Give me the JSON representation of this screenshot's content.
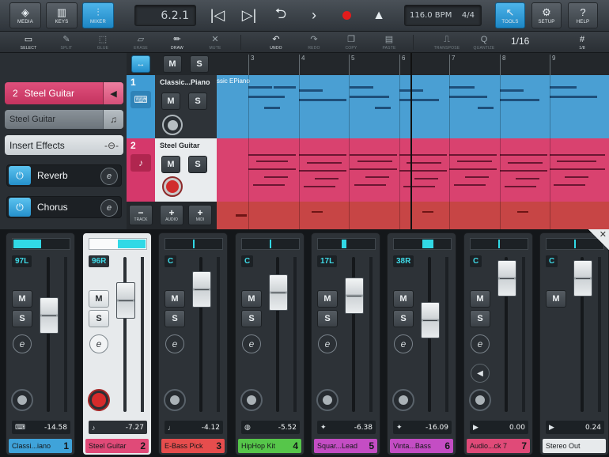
{
  "toolbar": {
    "media": "MEDIA",
    "keys": "KEYS",
    "mixer": "MIXER",
    "position": "6.2.1",
    "tempo": "116.0 BPM",
    "signature": "4/4",
    "tools": "TOOLS",
    "setup": "SETUP",
    "help": "HELP"
  },
  "toolbar2": {
    "select": "SELECT",
    "split": "SPLIT",
    "glue": "GLUE",
    "erase": "ERASE",
    "draw": "DRAW",
    "mute": "MUTE",
    "undo": "UNDO",
    "redo": "REDO",
    "copy": "COPY",
    "paste": "PASTE",
    "transpose": "TRANSPOSE",
    "quantize": "QUANTIZE",
    "quantize_value": "1/16",
    "grid": "1/8"
  },
  "inspector": {
    "track_number": "2",
    "track_name": "Steel Guitar",
    "instrument": "Steel Guitar",
    "insert_effects": "Insert Effects",
    "effects": [
      "Reverb",
      "Chorus"
    ]
  },
  "tracks": [
    {
      "number": "1",
      "name": "Classic...Piano",
      "color": "#4a9fd3"
    },
    {
      "number": "2",
      "name": "Steel Guitar",
      "color": "#d9426f"
    }
  ],
  "track_buttons": {
    "m": "M",
    "s": "S",
    "add_track": "TRACK",
    "add_audio": "AUDIO",
    "add_midi": "MIDI"
  },
  "arrange": {
    "clip1": "ssic EPiano",
    "ruler": [
      "3",
      "4",
      "5",
      "6",
      "7",
      "8",
      "9"
    ]
  },
  "mixer": {
    "channels": [
      {
        "pan": "97L",
        "pan_level": -0.97,
        "volume": "-14.58",
        "name": "Classi...iano",
        "number": "1",
        "color": "#3fa3da",
        "fader_level": 0.62
      },
      {
        "pan": "96R",
        "pan_level": 0.96,
        "volume": "-7.27",
        "name": "Steel Guitar",
        "number": "2",
        "color": "#e04a78",
        "fader_level": 0.72
      },
      {
        "pan": "C",
        "pan_level": 0,
        "volume": "-4.12",
        "name": "E-Bass Pick",
        "number": "3",
        "color": "#e64d4d",
        "fader_level": 0.79
      },
      {
        "pan": "C",
        "pan_level": 0,
        "volume": "-5.52",
        "name": "HipHop Kit",
        "number": "4",
        "color": "#56c64a",
        "fader_level": 0.77
      },
      {
        "pan": "17L",
        "pan_level": -0.17,
        "volume": "-6.38",
        "name": "Squar...Lead",
        "number": "5",
        "color": "#c44dc4",
        "fader_level": 0.75
      },
      {
        "pan": "38R",
        "pan_level": 0.38,
        "volume": "-16.09",
        "name": "Vinta...Bass",
        "number": "6",
        "color": "#c44dc4",
        "fader_level": 0.59
      },
      {
        "pan": "C",
        "pan_level": 0,
        "volume": "0.00",
        "name": "Audio...ck 7",
        "number": "7",
        "color": "#e04a78",
        "fader_level": 0.86
      },
      {
        "pan": "C",
        "pan_level": 0,
        "volume": "0.24",
        "name": "Stereo Out",
        "number": "",
        "color": "#e7eaec",
        "fader_level": 0.86
      }
    ]
  }
}
